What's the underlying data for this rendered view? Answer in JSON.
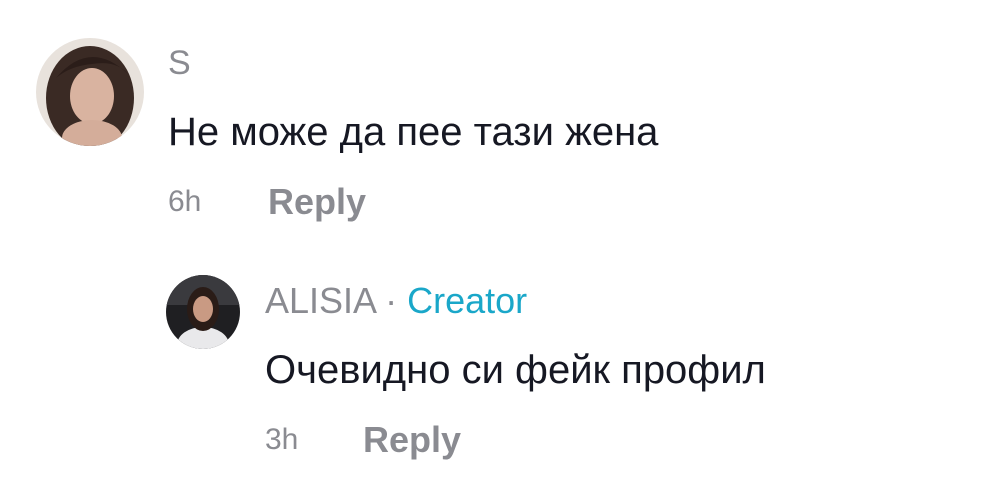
{
  "comments": [
    {
      "username": "S",
      "text": "Не може да пее тази жена",
      "time": "6h",
      "reply_label": "Reply"
    },
    {
      "username": "ALISIA",
      "separator": " · ",
      "badge": "Creator",
      "text": "Очевидно си фейк профил",
      "time": "3h",
      "reply_label": "Reply"
    }
  ],
  "colors": {
    "text": "#161823",
    "muted": "#8a8b91",
    "creator_badge": "#1aa7c9"
  }
}
